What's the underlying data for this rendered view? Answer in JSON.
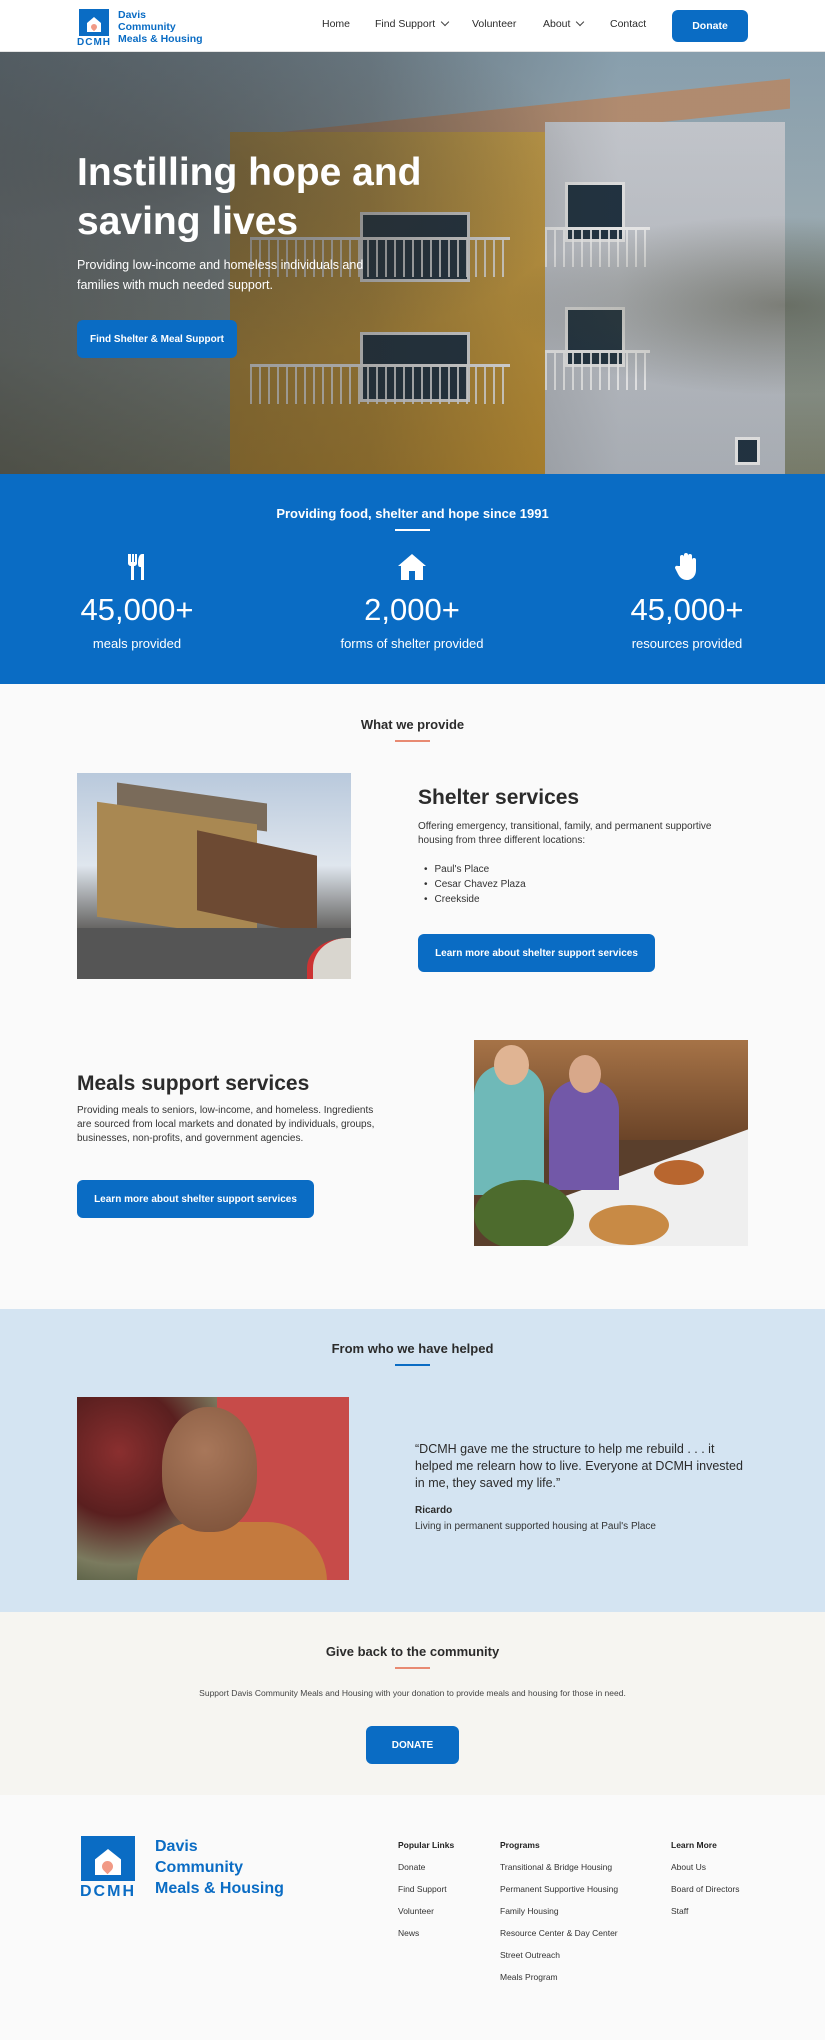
{
  "nav": {
    "logo_abbr": "DCMH",
    "logo_line1": "Davis",
    "logo_line2": "Community",
    "logo_line3": "Meals & Housing",
    "links": [
      "Home",
      "Find Support",
      "Volunteer",
      "About",
      "Contact"
    ],
    "donate": "Donate"
  },
  "hero": {
    "title_line1": "Instilling hope and",
    "title_line2": "saving lives",
    "subtitle": "Providing low-income and homeless individuals and families with much needed support.",
    "cta": "Find Shelter & Meal Support"
  },
  "stats": {
    "title": "Providing food, shelter and hope since 1991",
    "items": [
      {
        "icon": "utensils-icon",
        "number": "45,000+",
        "label": "meals provided"
      },
      {
        "icon": "house-icon",
        "number": "2,000+",
        "label": "forms of shelter provided"
      },
      {
        "icon": "hand-icon",
        "number": "45,000+",
        "label": "resources provided"
      }
    ]
  },
  "provide": {
    "title": "What we provide",
    "shelter": {
      "heading": "Shelter services",
      "text": "Offering emergency, transitional, family, and permanent supportive housing from three different locations:",
      "locations": [
        "Paul's Place",
        "Cesar Chavez Plaza",
        "Creekside"
      ],
      "cta": "Learn more about shelter support services"
    },
    "meals": {
      "heading": "Meals support services",
      "text": "Providing meals to seniors, low-income, and homeless. Ingredients are sourced from local markets and donated by individuals, groups, businesses, non-profits, and government agencies.",
      "cta": "Learn more about shelter support services"
    }
  },
  "testimonial": {
    "title": "From who we have helped",
    "quote": "“DCMH gave me the structure to help me rebuild . . . it helped me relearn how to live. Everyone at DCMH invested in me, they saved my life.”",
    "name": "Ricardo",
    "role": "Living in permanent supported housing at Paul's Place"
  },
  "giveback": {
    "title": "Give back to the community",
    "text": "Support Davis Community Meals and Housing with your donation to provide meals and housing for those in need.",
    "cta": "DONATE"
  },
  "footer": {
    "logo_abbr": "DCMH",
    "logo_line1": "Davis",
    "logo_line2": "Community",
    "logo_line3": "Meals & Housing",
    "popular": {
      "title": "Popular Links",
      "links": [
        "Donate",
        "Find Support",
        "Volunteer",
        "News"
      ]
    },
    "programs": {
      "title": "Programs",
      "links": [
        "Transitional & Bridge Housing",
        "Permanent Supportive Housing",
        "Family Housing",
        "Resource Center & Day Center",
        "Street Outreach",
        "Meals Program"
      ]
    },
    "learn": {
      "title": "Learn More",
      "links": [
        "About Us",
        "Board of Directors",
        "Staff"
      ]
    }
  },
  "colors": {
    "brand_blue": "#0a6cc4",
    "accent_salmon": "#e88a72",
    "light_blue_bg": "#d4e4f2"
  }
}
